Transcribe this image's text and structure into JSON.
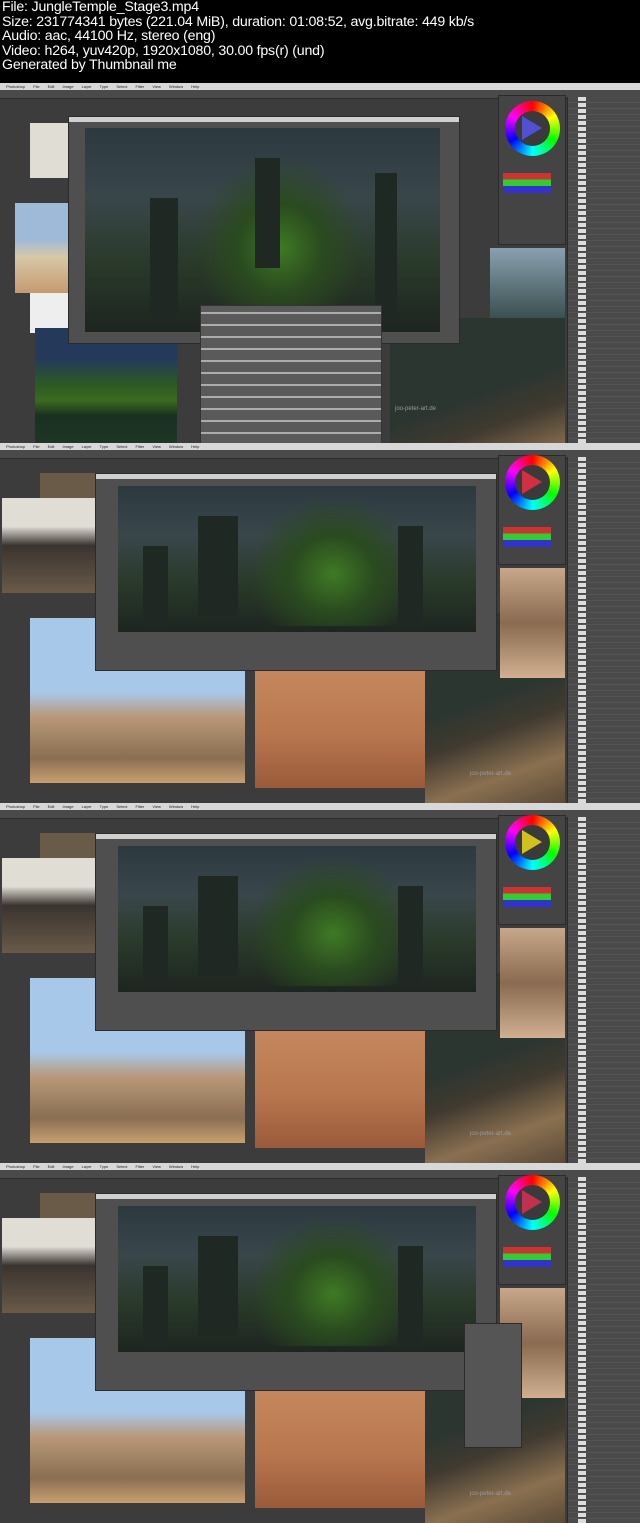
{
  "header": {
    "file": "File: JungleTemple_Stage3.mp4",
    "size": "Size: 231774341 bytes (221.04 MiB), duration: 01:08:52, avg.bitrate: 449 kb/s",
    "audio": "Audio: aac, 44100 Hz, stereo (eng)",
    "video": "Video: h264, yuv420p, 1920x1080, 30.00 fps(r) (und)",
    "generator": "Generated by Thumbnail me"
  },
  "menu": [
    "Photoshop",
    "File",
    "Edit",
    "Image",
    "Layer",
    "Type",
    "Select",
    "Filter",
    "View",
    "Window",
    "Help"
  ],
  "watermark": "joo-peter-art.de",
  "colors": {
    "bg": "#3c3c3c",
    "menubar": "#d8d8d8",
    "accent_green": "#3f7a25"
  }
}
